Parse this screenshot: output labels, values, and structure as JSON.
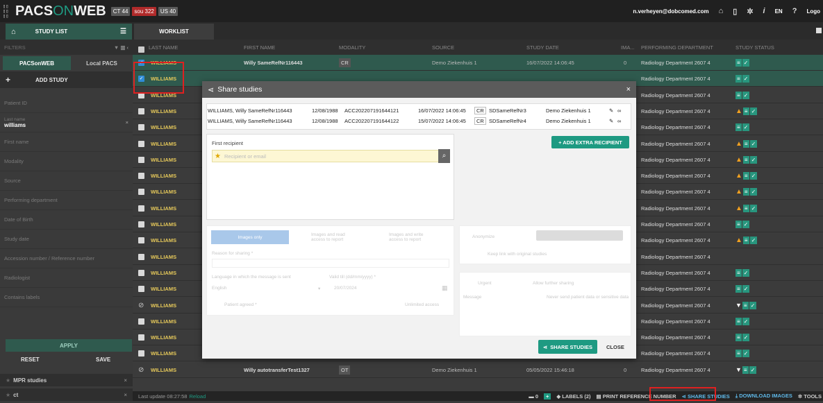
{
  "app": {
    "logo_part1": "PACS",
    "logo_part2": "ON",
    "logo_part3": "WEB",
    "logo_mark": "3|2 |/C",
    "badges": [
      {
        "label": "CT 44",
        "color": "#5a5a5a"
      },
      {
        "label": "sou 322",
        "color": "#b02a2a"
      },
      {
        "label": "US 40",
        "color": "#5a5a5a"
      }
    ],
    "user": "n.verheyen@dobcomed.com",
    "lang": "EN",
    "logout": "Logo"
  },
  "tabs": {
    "study_list": "STUDY LIST",
    "worklist": "WORKLIST"
  },
  "sidebar": {
    "filters_label": "FILTERS",
    "source_tabs": [
      "PACSonWEB",
      "Local PACS"
    ],
    "add_study": "ADD STUDY",
    "fields": [
      {
        "label": "Patient ID",
        "value": ""
      },
      {
        "label": "Last name",
        "value": "williams"
      },
      {
        "label": "First name",
        "value": ""
      },
      {
        "label": "Modality",
        "value": ""
      },
      {
        "label": "Source",
        "value": ""
      },
      {
        "label": "Performing department",
        "value": ""
      },
      {
        "label": "Date of Birth",
        "value": ""
      },
      {
        "label": "Study date",
        "value": ""
      },
      {
        "label": "Accession number / Reference number",
        "value": ""
      },
      {
        "label": "Radiologist",
        "value": ""
      },
      {
        "label": "Contains labels",
        "value": ""
      }
    ],
    "apply": "APPLY",
    "reset": "RESET",
    "save": "SAVE",
    "saved_filters": [
      "MPR studies",
      "ct"
    ]
  },
  "table": {
    "headers": [
      "LAST NAME",
      "FIRST NAME",
      "MODALITY",
      "SOURCE",
      "STUDY DATE",
      "IMA...",
      "PERFORMING DEPARTMENT",
      "STUDY STATUS"
    ],
    "rows": [
      {
        "last": "WILLIAMS",
        "first": "Willy SameRefNr116443",
        "mod": "CR",
        "source": "Demo Ziekenhuis 1",
        "date": "16/07/2022 14:06:45",
        "ima": "0",
        "dept": "Radiology Department 2607 4",
        "checked": true,
        "status": "doc"
      },
      {
        "last": "WILLIAMS",
        "first": "",
        "mod": "",
        "source": "",
        "date": "",
        "ima": "",
        "dept": "Radiology Department 2607 4",
        "checked": true,
        "status": "doc"
      },
      {
        "last": "WILLIAMS",
        "first": "",
        "mod": "",
        "source": "",
        "date": "",
        "ima": "",
        "dept": "Radiology Department 2607 4",
        "checked": false,
        "status": "doc"
      },
      {
        "last": "WILLIAMS",
        "first": "",
        "mod": "",
        "source": "",
        "date": "",
        "ima": "",
        "dept": "Radiology Department 2607 4",
        "checked": false,
        "status": "warn"
      },
      {
        "last": "WILLIAMS",
        "first": "",
        "mod": "",
        "source": "",
        "date": "",
        "ima": "",
        "dept": "Radiology Department 2607 4",
        "checked": false,
        "status": "doc"
      },
      {
        "last": "WILLIAMS",
        "first": "",
        "mod": "",
        "source": "",
        "date": "",
        "ima": "",
        "dept": "Radiology Department 2607 4",
        "checked": false,
        "status": "warn"
      },
      {
        "last": "WILLIAMS",
        "first": "",
        "mod": "",
        "source": "",
        "date": "",
        "ima": "",
        "dept": "Radiology Department 2607 4",
        "checked": false,
        "status": "warn"
      },
      {
        "last": "WILLIAMS",
        "first": "",
        "mod": "",
        "source": "",
        "date": "",
        "ima": "",
        "dept": "Radiology Department 2607 4",
        "checked": false,
        "status": "warn"
      },
      {
        "last": "WILLIAMS",
        "first": "",
        "mod": "",
        "source": "",
        "date": "",
        "ima": "",
        "dept": "Radiology Department 2607 4",
        "checked": false,
        "status": "warn"
      },
      {
        "last": "WILLIAMS",
        "first": "",
        "mod": "",
        "source": "",
        "date": "",
        "ima": "",
        "dept": "Radiology Department 2607 4",
        "checked": false,
        "status": "warn"
      },
      {
        "last": "WILLIAMS",
        "first": "",
        "mod": "",
        "source": "",
        "date": "",
        "ima": "",
        "dept": "Radiology Department 2607 4",
        "checked": false,
        "status": "doc"
      },
      {
        "last": "WILLIAMS",
        "first": "",
        "mod": "",
        "source": "",
        "date": "",
        "ima": "",
        "dept": "Radiology Department 2607 4",
        "checked": false,
        "status": "warn"
      },
      {
        "last": "WILLIAMS",
        "first": "",
        "mod": "",
        "source": "",
        "date": "",
        "ima": "",
        "dept": "Radiology Department 2607 4",
        "checked": false,
        "status": "none"
      },
      {
        "last": "WILLIAMS",
        "first": "",
        "mod": "",
        "source": "",
        "date": "",
        "ima": "",
        "dept": "Radiology Department 2607 4",
        "checked": false,
        "status": "doc"
      },
      {
        "last": "WILLIAMS",
        "first": "",
        "mod": "",
        "source": "",
        "date": "",
        "ima": "",
        "dept": "Radiology Department 2607 4",
        "checked": false,
        "status": "doc"
      },
      {
        "last": "WILLIAMS",
        "first": "",
        "mod": "",
        "source": "",
        "date": "",
        "ima": "",
        "dept": "Radiology Department 2607 4",
        "checked": false,
        "status": "filter",
        "blocked": true
      },
      {
        "last": "WILLIAMS",
        "first": "",
        "mod": "",
        "source": "",
        "date": "",
        "ima": "",
        "dept": "Radiology Department 2607 4",
        "checked": false,
        "status": "doc"
      },
      {
        "last": "WILLIAMS",
        "first": "",
        "mod": "",
        "source": "",
        "date": "",
        "ima": "",
        "dept": "Radiology Department 2607 4",
        "checked": false,
        "status": "doc"
      },
      {
        "last": "WILLIAMS",
        "first": "",
        "mod": "",
        "source": "",
        "date": "",
        "ima": "",
        "dept": "Radiology Department 2607 4",
        "checked": false,
        "status": "doc"
      },
      {
        "last": "WILLIAMS",
        "first": "Willy autotransferTest1327",
        "mod": "OT",
        "source": "Demo Ziekenhuis 1",
        "date": "05/05/2022 15:46:18",
        "ima": "0",
        "dept": "Radiology Department 2607 4",
        "checked": false,
        "status": "filter",
        "blocked": true
      }
    ]
  },
  "modal": {
    "title": "Share studies",
    "close": "×",
    "studies": [
      {
        "name": "WILLIAMS, Willy SameRefNr116443",
        "dob": "12/08/1988",
        "acc": "ACC202207191644121",
        "date": "16/07/2022 14:06:45",
        "mod": "CR",
        "ref": "SDSameRefNr3",
        "source": "Demo Ziekenhuis 1"
      },
      {
        "name": "WILLIAMS, Willy SameRefNr116443",
        "dob": "12/08/1988",
        "acc": "ACC202207191644122",
        "date": "15/07/2022 14:06:45",
        "mod": "CR",
        "ref": "SDSameRefNr4",
        "source": "Demo Ziekenhuis 1"
      }
    ],
    "first_recipient": "First recipient",
    "recipient_placeholder": "Recipient or email",
    "add_extra": "+ ADD EXTRA RECIPIENT",
    "opt_images_only": "Images only",
    "opt_read": "Images and read access to report",
    "opt_write": "Images and write access to report",
    "anonymize": "Anonymize",
    "keep_link": "Keep link with original studies",
    "reason": "Reason for sharing *",
    "language_label": "Language in which the message is sent",
    "language": "English",
    "valid_label": "Valid till (dd/mm/yyyy) *",
    "valid": "20/07/2024",
    "urgent": "Urgent",
    "allow_further": "Allow further sharing",
    "message": "Message",
    "message_hint": "Never send patient data or sensitive data",
    "patient_agreed": "Patient agreed *",
    "unlimited": "Unlimited access",
    "share": "SHARE STUDIES",
    "close_btn": "CLOSE"
  },
  "statusbar": {
    "last_update": "Last update 08:27:58",
    "reload": "Reload",
    "count": "0",
    "labels": "LABELS (2)",
    "print": "PRINT REFERENCE NUMBER",
    "share": "SHARE STUDIES",
    "download": "DOWNLOAD IMAGES",
    "tools": "TOOLS"
  }
}
